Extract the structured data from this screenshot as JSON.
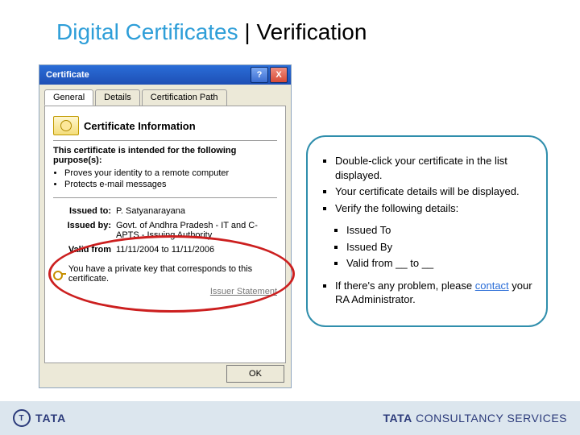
{
  "title": {
    "part1": "Digital Certificates",
    "sep": " | ",
    "part2": "Verification"
  },
  "dialog": {
    "window_title": "Certificate",
    "help_char": "?",
    "close_char": "X",
    "tabs": {
      "general": "General",
      "details": "Details",
      "path": "Certification Path"
    },
    "heading": "Certificate Information",
    "purpose_intro": "This certificate is intended for the following purpose(s):",
    "purpose1": "Proves your identity to a remote computer",
    "purpose2": "Protects e-mail messages",
    "issued_to_label": "Issued to:",
    "issued_to_value": "P. Satyanarayana",
    "issued_by_label": "Issued by:",
    "issued_by_value": "Govt. of Andhra Pradesh - IT and C-APTS - Issuing Authority",
    "valid_label": "Valid from",
    "valid_value": "11/11/2004 to 11/11/2006",
    "pkey_note": "You have a private key that corresponds to this certificate.",
    "issuer_link": "Issuer Statement",
    "ok": "OK"
  },
  "callout": {
    "b1": "Double-click your certificate in the list displayed.",
    "b2": "Your certificate details will be displayed.",
    "b3": "Verify the following details:",
    "s1": "Issued To",
    "s2": "Issued By",
    "s3": "Valid from __ to __",
    "b4_pre": "If there's any problem, please ",
    "b4_link": "contact",
    "b4_post": " your RA Administrator."
  },
  "footer": {
    "tata": "TATA",
    "tcs_bold": "TATA",
    "tcs_rest": " CONSULTANCY SERVICES"
  }
}
